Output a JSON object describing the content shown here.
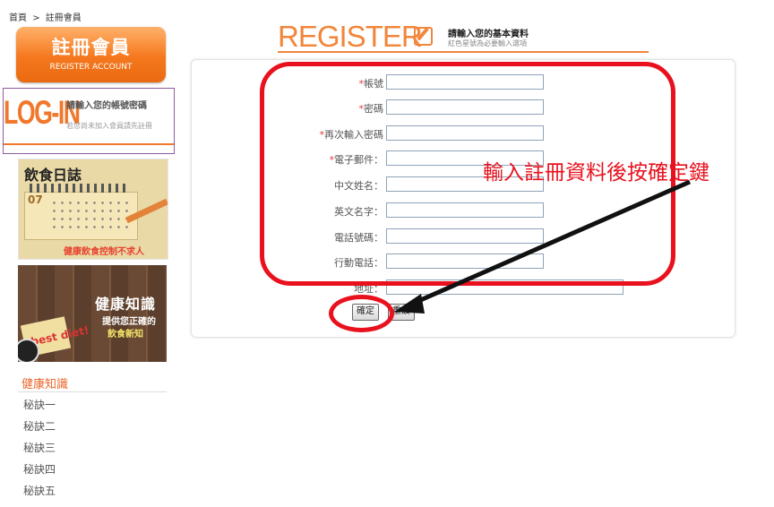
{
  "breadcrumb": {
    "home": "首頁",
    "sep": ">",
    "current": "註冊會員"
  },
  "sidebar": {
    "register_button": {
      "title": "註冊會員",
      "subtitle": "REGISTER ACCOUNT"
    },
    "login_banner": {
      "title": "LOG-IN",
      "line1": "請輸入您的帳號密碼",
      "line2": "若您尚未加入會員請先註冊"
    },
    "diary_banner": {
      "title": "飲食日誌",
      "month": "07",
      "caption": "健康飲食控制不求人"
    },
    "knowledge_banner": {
      "title": "健康知識",
      "line1": "提供您正確的",
      "line2": "飲食新知",
      "note": "best diet!"
    },
    "knowledge_section": {
      "title": "健康知識",
      "items": [
        "秘訣一",
        "秘訣二",
        "秘訣三",
        "秘訣四",
        "秘訣五"
      ]
    }
  },
  "header": {
    "title": "REGISTER",
    "subtitle": "請輸入您的基本資料",
    "note": "紅色星號為必要輸入選項",
    "icon": "pencil-icon"
  },
  "form": {
    "fields": [
      {
        "name": "account",
        "label": "帳號",
        "required": true,
        "value": ""
      },
      {
        "name": "password",
        "label": "密碼",
        "required": true,
        "value": ""
      },
      {
        "name": "password-confirm",
        "label": "再次輸入密碼",
        "required": true,
        "value": ""
      },
      {
        "name": "email",
        "label": "電子郵件：",
        "required": true,
        "value": ""
      },
      {
        "name": "chinese-name",
        "label": "中文姓名：",
        "required": false,
        "value": ""
      },
      {
        "name": "english-name",
        "label": "英文名字：",
        "required": false,
        "value": ""
      },
      {
        "name": "phone",
        "label": "電話號碼：",
        "required": false,
        "value": ""
      },
      {
        "name": "mobile",
        "label": "行動電話：",
        "required": false,
        "value": ""
      },
      {
        "name": "address",
        "label": "地址：",
        "required": false,
        "value": ""
      }
    ],
    "required_mark": "*",
    "submit_label": "確定",
    "reset_label": "重設"
  },
  "annotation": {
    "text": "輸入註冊資料後按確定鍵",
    "color": "#e8111d"
  },
  "colors": {
    "accent": "#f2863b",
    "annotation": "#e8111d"
  }
}
